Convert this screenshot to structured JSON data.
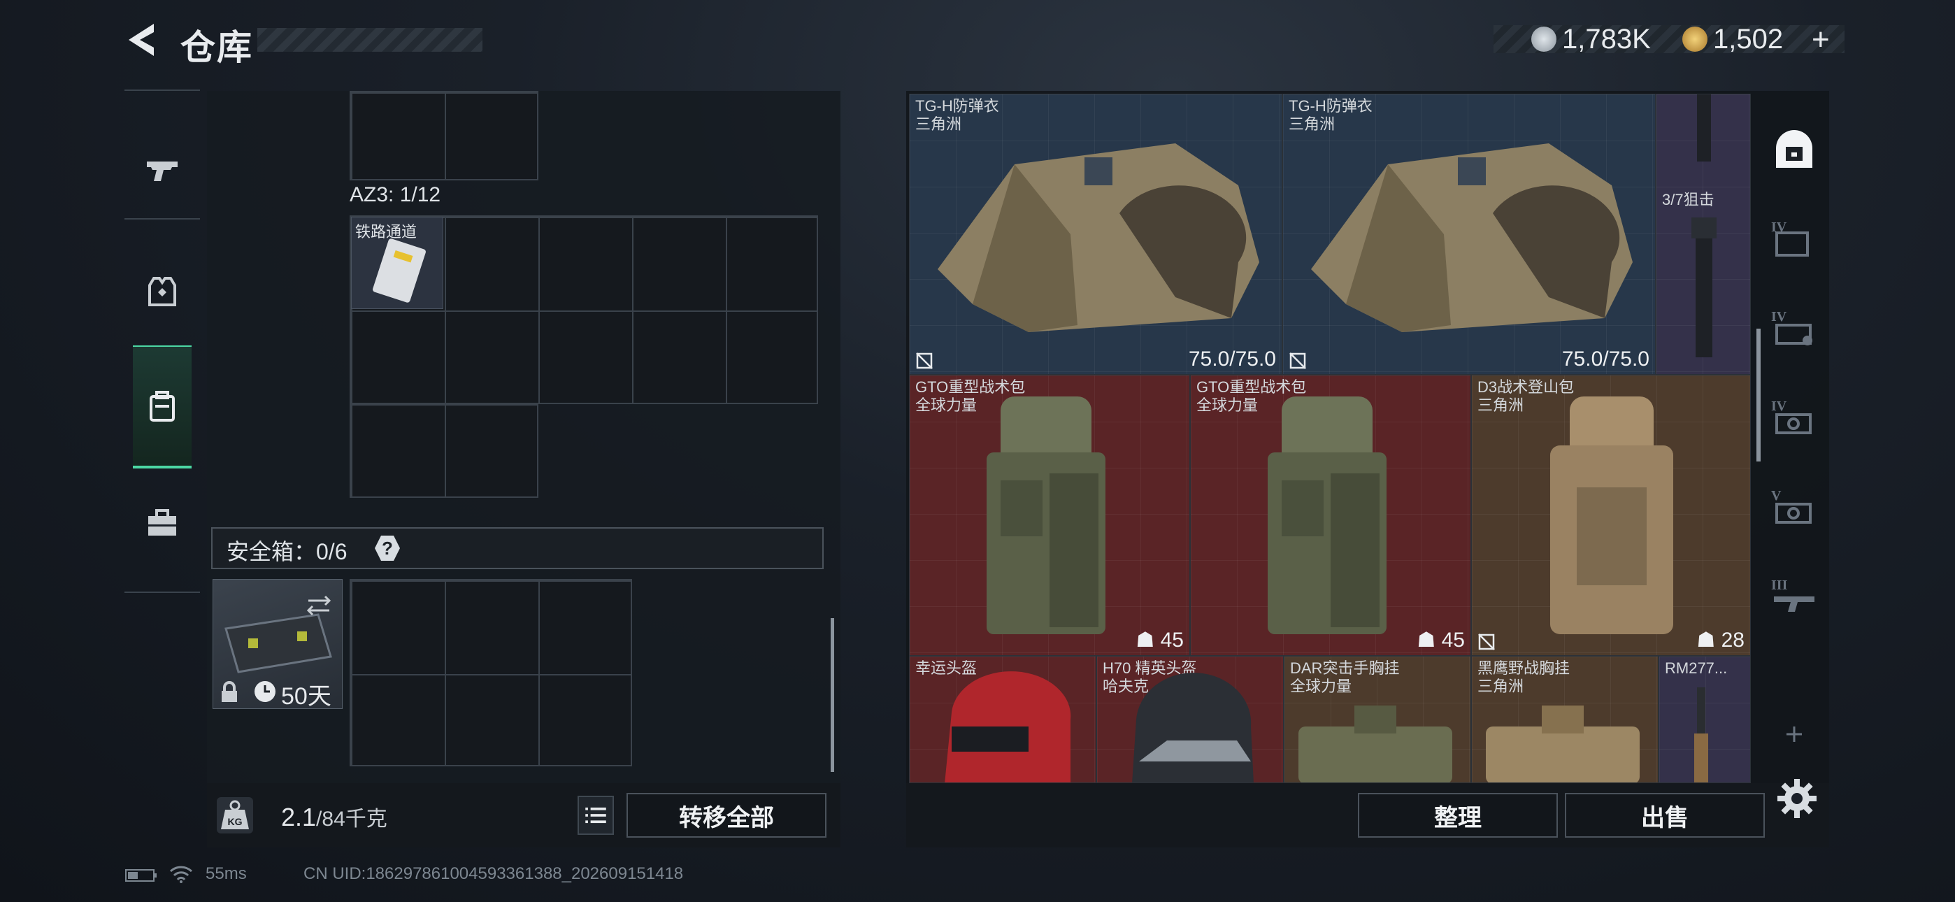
{
  "header": {
    "title": "仓库",
    "back_icon": "back-arrow-icon"
  },
  "currency": {
    "coins": "1,783K",
    "bonds": "1,502",
    "add_label": "+",
    "coin_color": "#b9c2cc",
    "bond_color": "#d8a94a"
  },
  "left_tabs": [
    {
      "icon": "pistol-icon"
    },
    {
      "icon": "armor-vest-icon"
    },
    {
      "icon": "backpack-icon",
      "active": true
    },
    {
      "icon": "toolbox-icon"
    }
  ],
  "storage": {
    "az3_label": "AZ3: 1/12",
    "rail_item_label": "铁路通道",
    "safe_box_label": "安全箱：0/6",
    "safe_help": "?",
    "safe_case_timer": "50天"
  },
  "weight": {
    "current": "2.1",
    "capacity": "/84千克"
  },
  "buttons": {
    "transfer_all": "转移全部",
    "sort": "整理",
    "sell": "出售"
  },
  "items": [
    {
      "name": "TG-H防弹衣",
      "sub": "三角洲",
      "value": "75.0/75.0",
      "rarity": "blue"
    },
    {
      "name": "TG-H防弹衣",
      "sub": "三角洲",
      "value": "75.0/75.0",
      "rarity": "blue"
    },
    {
      "name": "3/7狙击",
      "sub": "",
      "value": "",
      "rarity": "purple"
    },
    {
      "name": "GTO重型战术包",
      "sub": "全球力量",
      "value": "45",
      "rarity": "red"
    },
    {
      "name": "GTO重型战术包",
      "sub": "全球力量",
      "value": "45",
      "rarity": "red"
    },
    {
      "name": "D3战术登山包",
      "sub": "三角洲",
      "value": "28",
      "rarity": "tan"
    },
    {
      "name": "幸运头盔",
      "sub": "",
      "value": "",
      "rarity": "red"
    },
    {
      "name": "H70 精英头盔",
      "sub": "哈夫克",
      "value": "",
      "rarity": "red"
    },
    {
      "name": "DAR突击手胸挂",
      "sub": "全球力量",
      "value": "",
      "rarity": "tan"
    },
    {
      "name": "黑鹰野战胸挂",
      "sub": "三角洲",
      "value": "",
      "rarity": "tan"
    },
    {
      "name": "RM277...",
      "sub": "",
      "value": "",
      "rarity": "purple"
    }
  ],
  "filters": [
    "home-safe-icon",
    "tier-4-folder-icon",
    "tier-4-case-icon",
    "tier-4-camera-icon",
    "tier-5-camera-icon",
    "tier-3-gun-icon",
    "add-icon"
  ],
  "filter_tiers": [
    "IV",
    "IV",
    "IV",
    "V",
    "III"
  ],
  "status": {
    "ping": "55ms",
    "uid": "CN UID:1862978610045933613​88_202609151418"
  }
}
